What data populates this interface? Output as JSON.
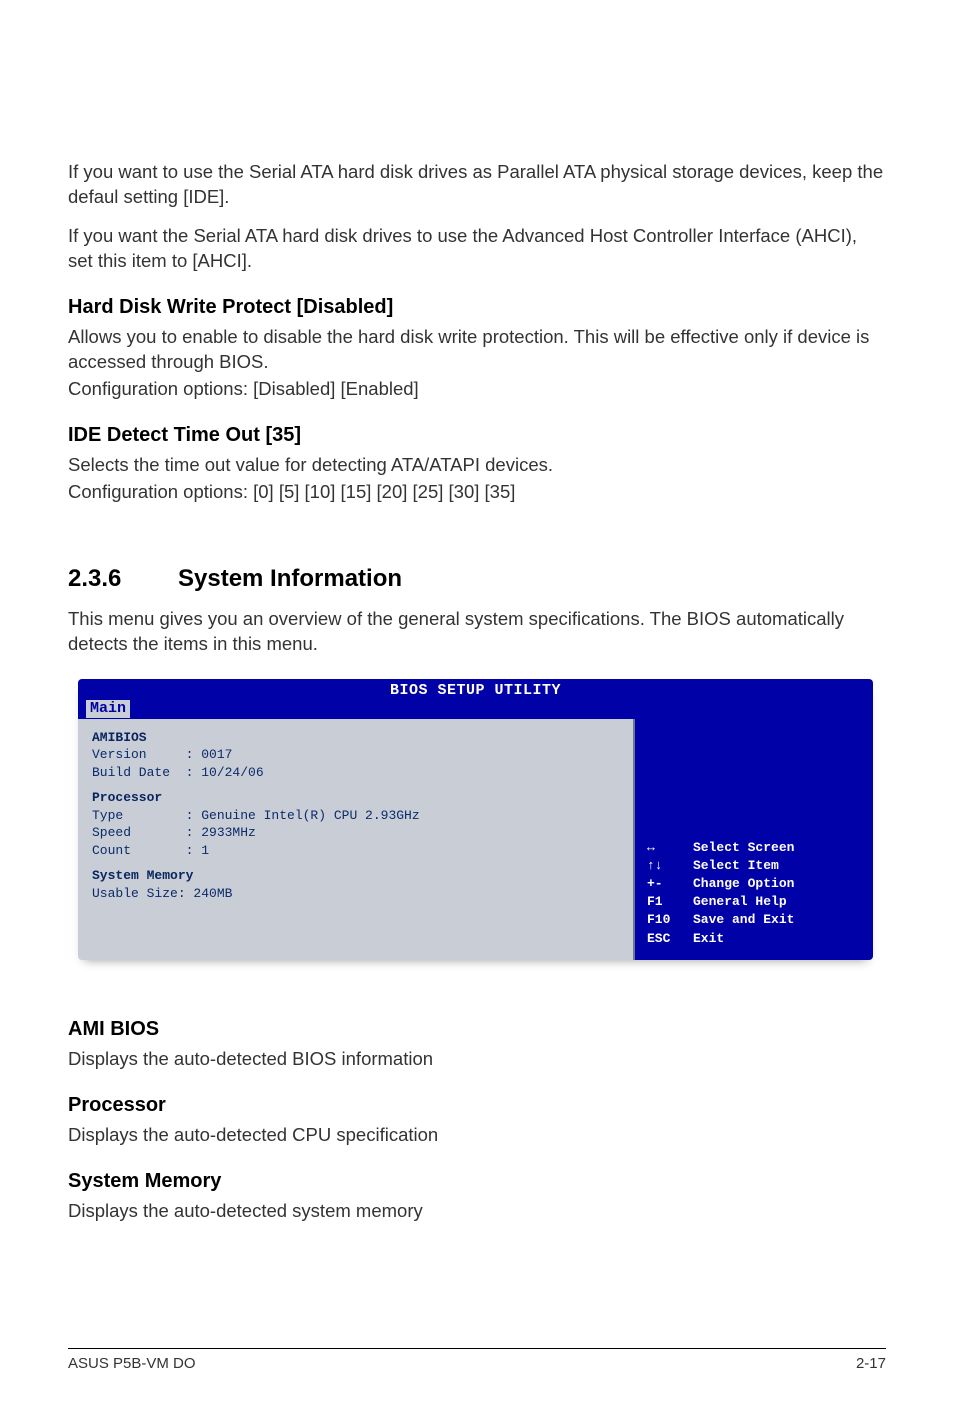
{
  "intro": {
    "p1": "If you want to use the Serial ATA hard disk drives as Parallel ATA physical storage devices, keep the defaul setting [IDE].",
    "p2": "If you want the Serial ATA hard disk drives to use the Advanced Host Controller Interface (AHCI), set this item to [AHCI]."
  },
  "hdwp": {
    "title": "Hard Disk Write Protect [Disabled]",
    "p1": "Allows you to enable to disable the hard disk write protection. This will be effective only if device is accessed through BIOS.",
    "p2": "Configuration options: [Disabled] [Enabled]"
  },
  "ide": {
    "title": "IDE Detect Time Out [35]",
    "p1": "Selects the time out value for detecting ATA/ATAPI devices.",
    "p2": "Configuration options: [0] [5] [10] [15] [20] [25] [30] [35]"
  },
  "sec236": {
    "num": "2.3.6",
    "title": "System Information",
    "p1": "This menu gives you an overview of the general system specifications. The BIOS automatically detects the items in this menu."
  },
  "bios": {
    "header": "BIOS SETUP UTILITY",
    "tab": "Main",
    "left": {
      "l1": "AMIBIOS",
      "l2": "Version     : 0017",
      "l3": "Build Date  : 10/24/06",
      "l4": "Processor",
      "l5": "Type        : Genuine Intel(R) CPU 2.93GHz",
      "l6": "Speed       : 2933MHz",
      "l7": "Count       : 1",
      "l8": "System Memory",
      "l9": "Usable Size: 240MB"
    },
    "help": [
      {
        "key": "↔",
        "txt": "Select Screen"
      },
      {
        "key": "↑↓",
        "txt": "Select Item"
      },
      {
        "key": "+-",
        "txt": "Change Option"
      },
      {
        "key": "F1",
        "txt": "General Help"
      },
      {
        "key": "F10",
        "txt": "Save and Exit"
      },
      {
        "key": "ESC",
        "txt": "Exit"
      }
    ]
  },
  "amibios": {
    "title": "AMI BIOS",
    "p1": "Displays the auto-detected BIOS information"
  },
  "processor": {
    "title": "Processor",
    "p1": "Displays the auto-detected CPU specification"
  },
  "sysmem": {
    "title": "System Memory",
    "p1": "Displays the auto-detected system memory"
  },
  "footer": {
    "left": "ASUS P5B-VM DO",
    "right": "2-17"
  }
}
